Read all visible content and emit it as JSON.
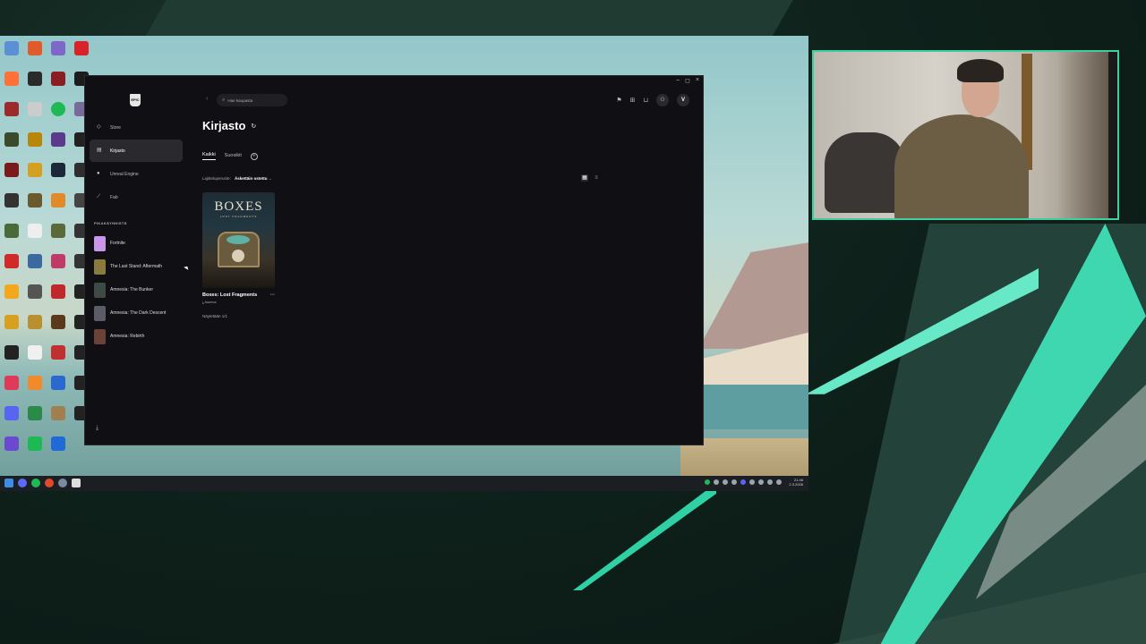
{
  "launcher": {
    "window_controls": {
      "minimize": "‒",
      "maximize": "◻",
      "close": "×"
    },
    "logo_text": "EPIC",
    "nav": [
      {
        "label": "Store",
        "icon": "tag-icon"
      },
      {
        "label": "Kirjasto",
        "icon": "grid-icon",
        "active": true
      },
      {
        "label": "Unreal Engine",
        "icon": "unreal-icon"
      },
      {
        "label": "Fab",
        "icon": "fab-icon"
      }
    ],
    "quick_launch_title": "PIKAKÄYNNISTÄ",
    "quick_launch": [
      {
        "label": "Fortnite",
        "color": "#c996e8"
      },
      {
        "label": "The Last Stand: Aftermath",
        "color": "#8a7a3e"
      },
      {
        "label": "Amnesia: The Bunker",
        "color": "#3e4a44"
      },
      {
        "label": "Amnesia: The Dark Descent",
        "color": "#5a5c66"
      },
      {
        "label": "Amnesia: Rebirth",
        "color": "#6a4238"
      }
    ],
    "search": {
      "placeholder": "Hae kaupasta"
    },
    "avatar_initial": "V",
    "page_title": "Kirjasto",
    "tabs": {
      "all": "Kaikki",
      "favorites": "Suosikit"
    },
    "sort": {
      "label": "Lajitteluperuste:",
      "value": "Äskettäin ostettu"
    },
    "game": {
      "cover_title": "BOXES",
      "cover_subtitle": "LOST FRAGMENTS",
      "name": "Boxes: Lost Fragments",
      "action": "Asenna"
    },
    "shown_count": "Näytetään 1/1"
  },
  "taskbar": {
    "time": "21.46",
    "date": "2.3.2026"
  },
  "colors": {
    "accent": "#3ecf9f",
    "launcher_bg": "#101014",
    "active_nav": "#2a2a2e"
  }
}
